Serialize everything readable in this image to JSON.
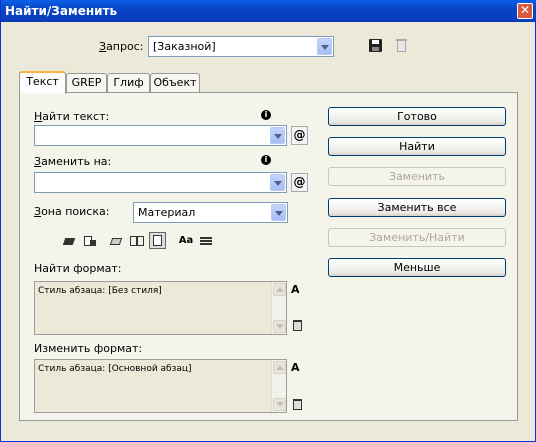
{
  "window": {
    "title": "Найти/Заменить",
    "close": "✕"
  },
  "query": {
    "label": "Запрос:",
    "value": "[Заказной]"
  },
  "tabs": [
    {
      "label": "Текст",
      "active": true
    },
    {
      "label": "GREP"
    },
    {
      "label": "Глиф"
    },
    {
      "label": "Объект"
    }
  ],
  "find": {
    "label": "Найти текст:",
    "value": ""
  },
  "replace": {
    "label": "Заменить на:",
    "value": ""
  },
  "search_zone": {
    "label": "Зона поиска:",
    "value": "Материал"
  },
  "find_format": {
    "label": "Найти формат:",
    "text": "Стиль абзаца: [Без стиля]"
  },
  "change_format": {
    "label": "Изменить формат:",
    "text": "Стиль абзаца: [Основной абзац]"
  },
  "buttons": {
    "done": "Готово",
    "find": "Найти",
    "replace": "Заменить",
    "replace_all": "Заменить все",
    "replace_find": "Заменить/Найти",
    "less": "Меньше"
  },
  "icons": {
    "info": "i",
    "special_chars": "@",
    "case": "Aa"
  }
}
